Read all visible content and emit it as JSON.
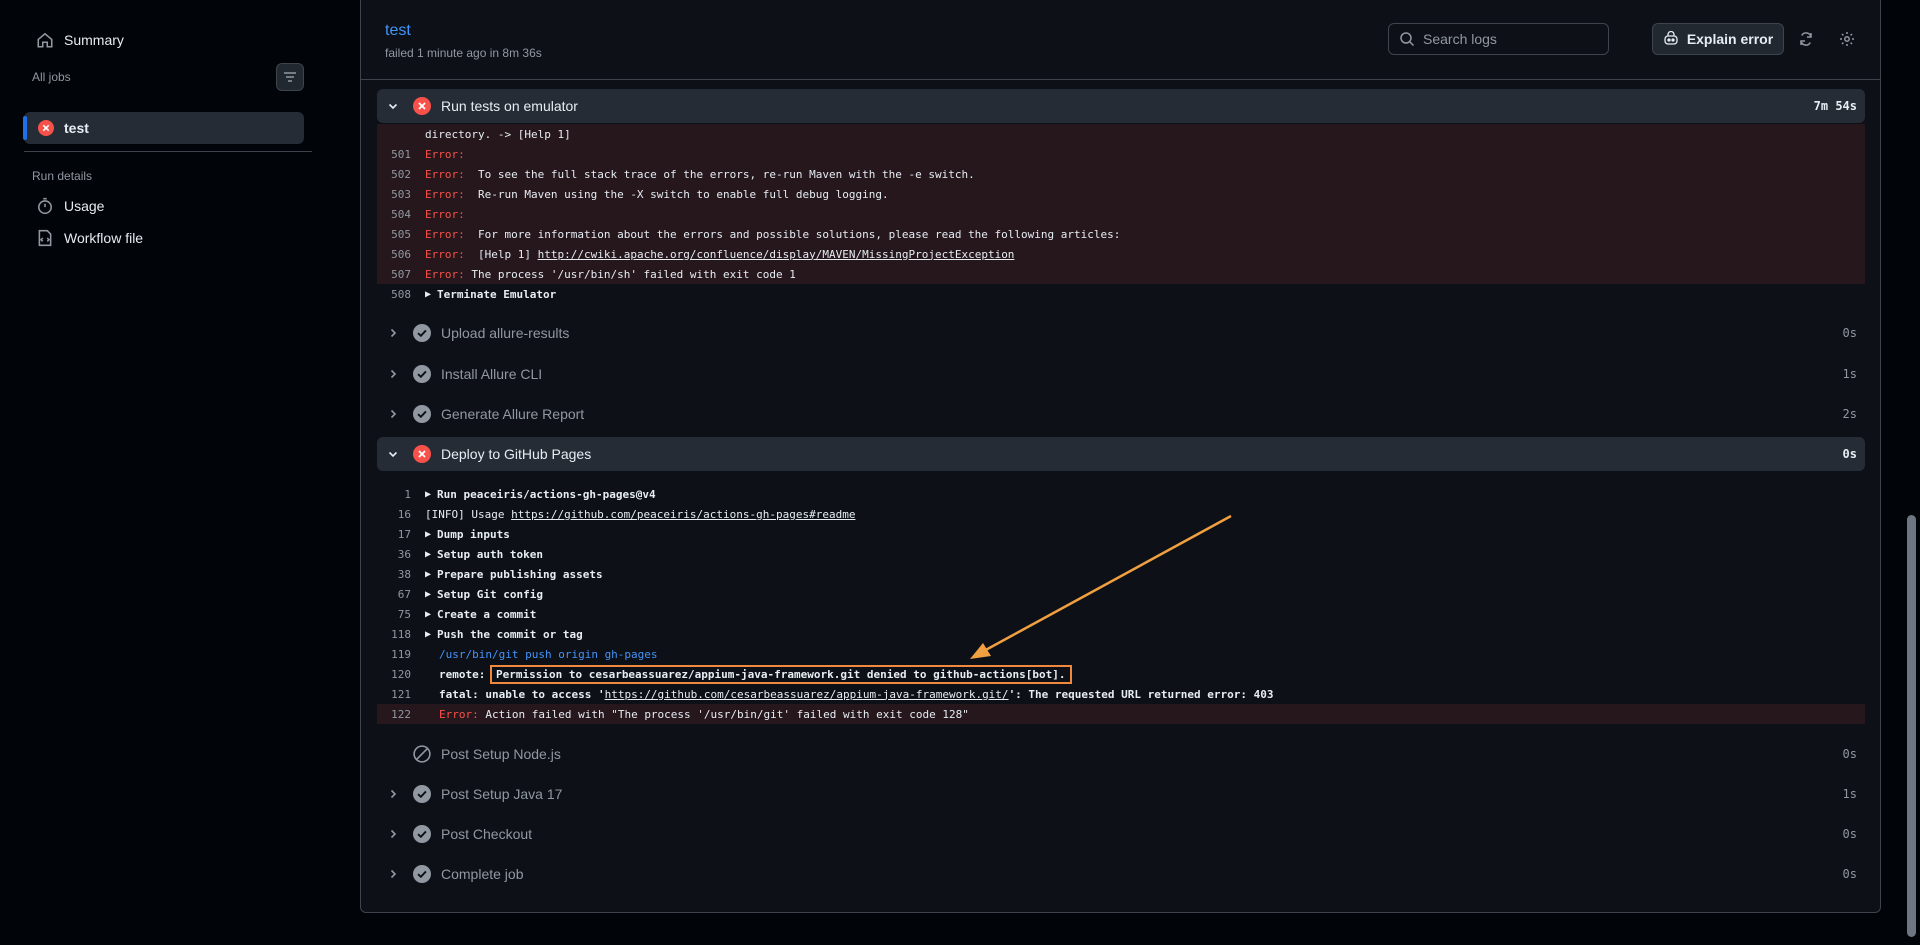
{
  "sidebar": {
    "summary": "Summary",
    "all_jobs": "All jobs",
    "job": "test",
    "run_details": "Run details",
    "usage": "Usage",
    "workflow_file": "Workflow file"
  },
  "header": {
    "title": "test",
    "subtitle": "failed 1 minute ago in 8m 36s",
    "search_placeholder": "Search logs",
    "explain_label": "Explain error"
  },
  "steps": {
    "run_tests": {
      "name": "Run tests on emulator",
      "duration": "7m 54s"
    },
    "upload": {
      "name": "Upload allure-results",
      "duration": "0s"
    },
    "install_allure": {
      "name": "Install Allure CLI",
      "duration": "1s"
    },
    "generate": {
      "name": "Generate Allure Report",
      "duration": "2s"
    },
    "deploy": {
      "name": "Deploy to GitHub Pages",
      "duration": "0s"
    },
    "post_node": {
      "name": "Post Setup Node.js",
      "duration": "0s"
    },
    "post_java": {
      "name": "Post Setup Java 17",
      "duration": "1s"
    },
    "post_checkout": {
      "name": "Post Checkout",
      "duration": "0s"
    },
    "complete": {
      "name": "Complete job",
      "duration": "0s"
    }
  },
  "run_tests_log": {
    "l500": {
      "num": "",
      "text": "directory. -> [Help 1]"
    },
    "l501": {
      "num": "501",
      "tag": "Error:",
      "text": ""
    },
    "l502": {
      "num": "502",
      "tag": "Error:",
      "text": "  To see the full stack trace of the errors, re-run Maven with the -e switch."
    },
    "l503": {
      "num": "503",
      "tag": "Error:",
      "text": "  Re-run Maven using the -X switch to enable full debug logging."
    },
    "l504": {
      "num": "504",
      "tag": "Error:",
      "text": ""
    },
    "l505": {
      "num": "505",
      "tag": "Error:",
      "text": "  For more information about the errors and possible solutions, please read the following articles:"
    },
    "l506": {
      "num": "506",
      "tag": "Error:",
      "text": "  [Help 1] ",
      "link": "http://cwiki.apache.org/confluence/display/MAVEN/MissingProjectException"
    },
    "l507": {
      "num": "507",
      "tag": "Error:",
      "text": " The process '/usr/bin/sh' failed with exit code 1"
    },
    "l508": {
      "num": "508",
      "text": "Terminate Emulator"
    }
  },
  "deploy_log": {
    "l1": {
      "num": "1",
      "text": "Run peaceiris/actions-gh-pages@v4"
    },
    "l16": {
      "num": "16",
      "text": "[INFO] Usage ",
      "link": "https://github.com/peaceiris/actions-gh-pages#readme"
    },
    "l17": {
      "num": "17",
      "text": "Dump inputs"
    },
    "l36": {
      "num": "36",
      "text": "Setup auth token"
    },
    "l38": {
      "num": "38",
      "text": "Prepare publishing assets"
    },
    "l67": {
      "num": "67",
      "text": "Setup Git config"
    },
    "l75": {
      "num": "75",
      "text": "Create a commit"
    },
    "l118": {
      "num": "118",
      "text": "Push the commit or tag"
    },
    "l119": {
      "num": "119",
      "text": "/usr/bin/git push origin gh-pages"
    },
    "l120": {
      "num": "120",
      "prefix": "remote: ",
      "text": "Permission to cesarbeassuarez/appium-java-framework.git denied to github-actions[bot]."
    },
    "l121": {
      "num": "121",
      "prefix": "fatal: unable to access '",
      "link": "https://github.com/cesarbeassuarez/appium-java-framework.git/",
      "suffix": "': The requested URL returned error: 403"
    },
    "l122": {
      "num": "122",
      "tag": "Error:",
      "text": " Action failed with \"The process '/usr/bin/git' failed with exit code 128\""
    }
  },
  "icons": {
    "home": "home-icon",
    "filter": "filter-icon",
    "x_circle": "x-circle-icon",
    "stopwatch": "stopwatch-icon",
    "workflow": "workflow-file-icon",
    "search": "search-icon",
    "copilot": "copilot-icon",
    "refresh": "sync-icon",
    "gear": "gear-icon",
    "check_circle": "check-circle-icon",
    "skipped": "skip-icon"
  },
  "colors": {
    "error": "#f85149",
    "link": "#4493f8",
    "highlight": "#f0883e"
  }
}
